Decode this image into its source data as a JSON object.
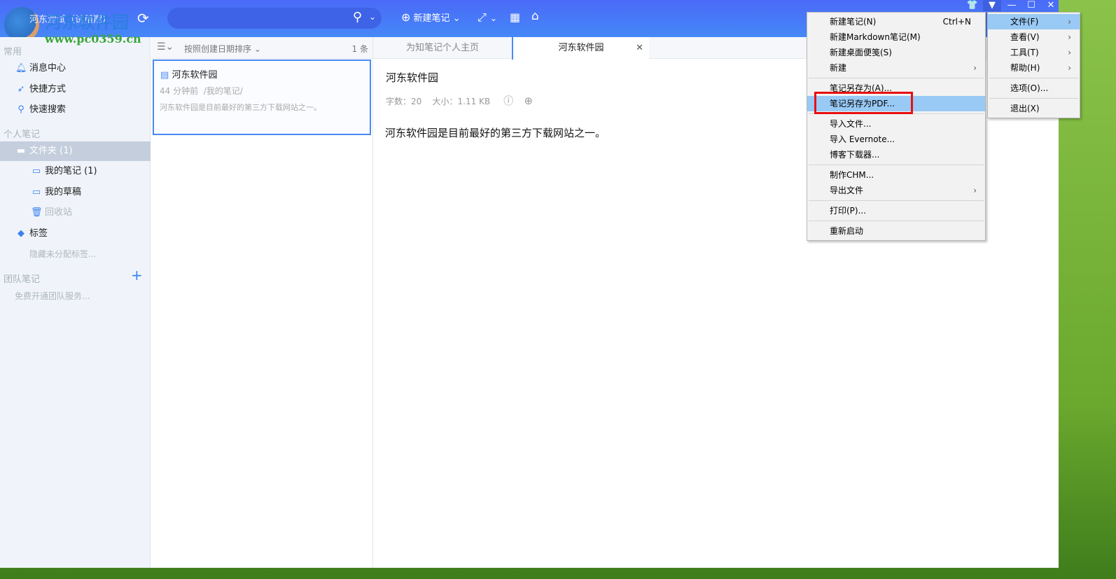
{
  "header": {
    "user": "河东测试（试用期）",
    "search_placeholder": "",
    "new_note": "新建笔记",
    "watermark": "河东软件园",
    "watermark_url": "www.pc0359.cn"
  },
  "sidebar": {
    "common": "常用",
    "items": [
      {
        "label": "消息中心",
        "icon": "bell-icon"
      },
      {
        "label": "快捷方式",
        "icon": "rocket-icon"
      },
      {
        "label": "快速搜索",
        "icon": "search-icon"
      }
    ],
    "personal": "个人笔记",
    "folder": "文件夹 (1)",
    "my_notes": "我的笔记 (1)",
    "drafts": "我的草稿",
    "trash": "回收站",
    "tags": "标签",
    "hidden_tags": "隐藏未分配标签...",
    "team": "团队笔记",
    "team_free": "免费开通团队服务..."
  },
  "list": {
    "sort": "按照创建日期排序",
    "count": "1 条",
    "note": {
      "title": "河东软件园",
      "meta": "44 分钟前  /我的笔记/",
      "preview": "河东软件园是目前最好的第三方下载网站之一。"
    }
  },
  "tabs": [
    {
      "label": "为知笔记个人主页"
    },
    {
      "label": "河东软件园"
    }
  ],
  "editor": {
    "title": "河东软件园",
    "words": "字数：20",
    "size": "大小：1.11 KB",
    "body": "河东软件园是目前最好的第三方下载网站之一。"
  },
  "menu": {
    "items": [
      {
        "label": "新建笔记(N)",
        "shortcut": "Ctrl+N"
      },
      {
        "label": "新建Markdown笔记(M)"
      },
      {
        "label": "新建桌面便笺(S)"
      },
      {
        "label": "新建",
        "submenu": true
      },
      {
        "sep": true
      },
      {
        "label": "笔记另存为(A)..."
      },
      {
        "label": "笔记另存为PDF...",
        "highlight": true
      },
      {
        "sep": true
      },
      {
        "label": "导入文件..."
      },
      {
        "label": "导入 Evernote..."
      },
      {
        "label": "博客下载器..."
      },
      {
        "sep": true
      },
      {
        "label": "制作CHM..."
      },
      {
        "label": "导出文件",
        "submenu": true
      },
      {
        "sep": true
      },
      {
        "label": "打印(P)..."
      },
      {
        "sep": true
      },
      {
        "label": "重新启动"
      }
    ]
  },
  "submenu": {
    "items": [
      {
        "label": "文件(F)",
        "submenu": true,
        "highlight": true
      },
      {
        "label": "查看(V)",
        "submenu": true
      },
      {
        "label": "工具(T)",
        "submenu": true
      },
      {
        "label": "帮助(H)",
        "submenu": true
      },
      {
        "sep": true
      },
      {
        "label": "选项(O)..."
      },
      {
        "sep": true
      },
      {
        "label": "退出(X)"
      }
    ]
  },
  "colors": {
    "header": "#4a6af7",
    "accent": "#4a8af4",
    "highlight": "#99c9f5",
    "callout": "#e81010"
  }
}
